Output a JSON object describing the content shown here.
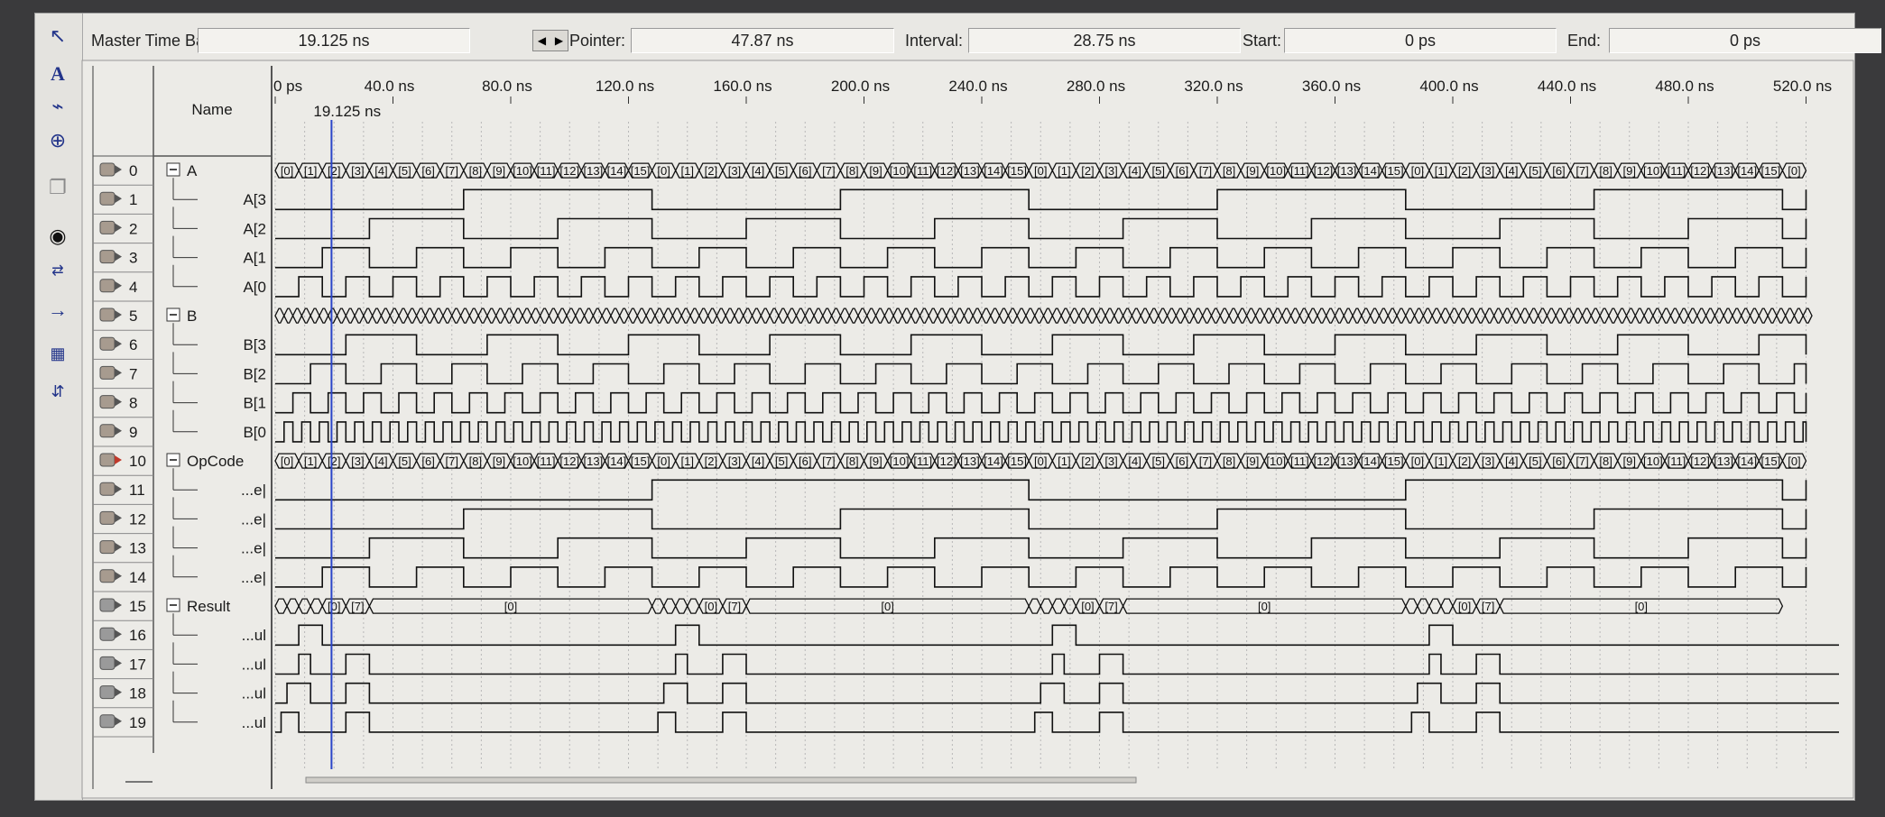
{
  "toolbar": {
    "tools": [
      "pointer-icon",
      "text-icon",
      "waveform-edit-icon",
      "zoom-icon",
      "copy-icon",
      "find-icon",
      "replace-icon",
      "arrow-right-icon",
      "group-icon",
      "sort-icon"
    ]
  },
  "topbar": {
    "master_time_bar_label": "Master Time Bar:",
    "master_time_bar_value": "19.125 ns",
    "pointer_label": "Pointer:",
    "pointer_value": "47.87 ns",
    "interval_label": "Interval:",
    "interval_value": "28.75 ns",
    "start_label": "Start:",
    "start_value": "0 ps",
    "end_label": "End:",
    "end_value": "0 ps"
  },
  "header": {
    "name_label": "Name",
    "cursor_label": "19.125 ns",
    "time_ticks": [
      "0 ps",
      "40.0 ns",
      "80.0 ns",
      "120.0 ns",
      "160.0 ns",
      "200.0 ns",
      "240.0 ns",
      "280.0 ns",
      "320.0 ns",
      "360.0 ns",
      "400.0 ns",
      "440.0 ns",
      "480.0 ns",
      "520.0 ns"
    ]
  },
  "signals": [
    {
      "index": "0",
      "name": "A",
      "group": true
    },
    {
      "index": "1",
      "name": "A[3"
    },
    {
      "index": "2",
      "name": "A[2"
    },
    {
      "index": "3",
      "name": "A[1"
    },
    {
      "index": "4",
      "name": "A[0"
    },
    {
      "index": "5",
      "name": "B",
      "group": true
    },
    {
      "index": "6",
      "name": "B[3"
    },
    {
      "index": "7",
      "name": "B[2"
    },
    {
      "index": "8",
      "name": "B[1"
    },
    {
      "index": "9",
      "name": "B[0"
    },
    {
      "index": "10",
      "name": "OpCode",
      "group": true
    },
    {
      "index": "11",
      "name": "...e|"
    },
    {
      "index": "12",
      "name": "...e|"
    },
    {
      "index": "13",
      "name": "...e|"
    },
    {
      "index": "14",
      "name": "...e|"
    },
    {
      "index": "15",
      "name": "Result",
      "group": true
    },
    {
      "index": "16",
      "name": "...ul"
    },
    {
      "index": "17",
      "name": "...ul"
    },
    {
      "index": "18",
      "name": "...ul"
    },
    {
      "index": "19",
      "name": "...ul"
    }
  ],
  "colors": {
    "background": "#e9e8e4",
    "waveform": "#111111",
    "cursor": "#2a44c8",
    "grid": "#b8b8b8"
  }
}
